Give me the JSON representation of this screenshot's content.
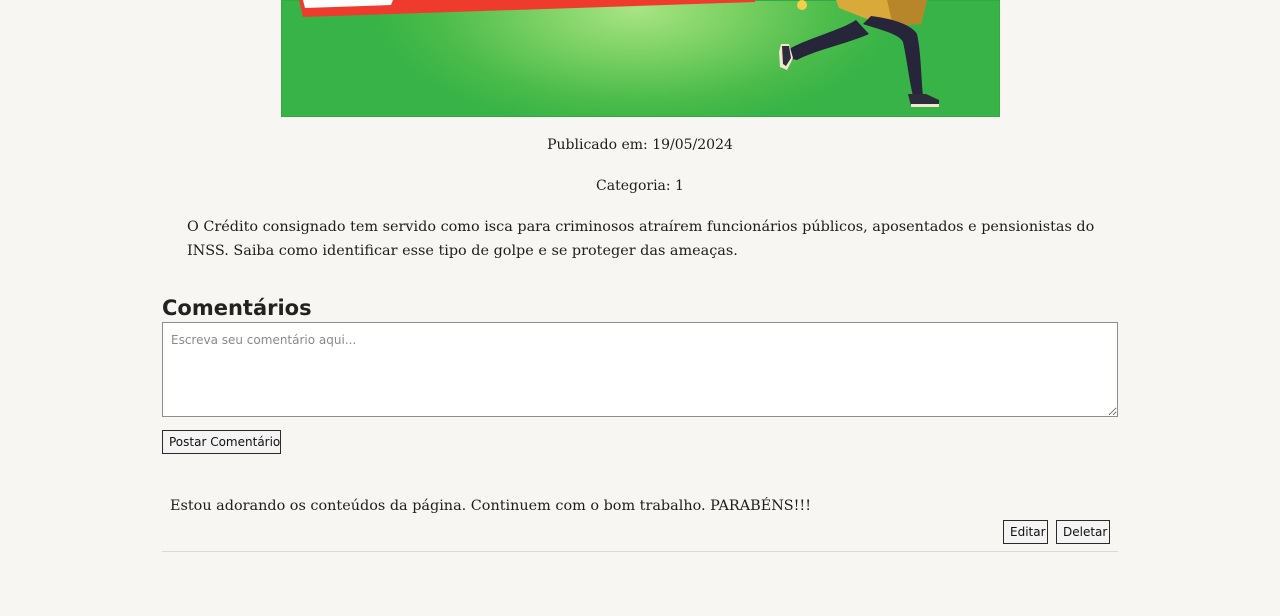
{
  "post": {
    "published_label": "Publicado em: 19/05/2024",
    "category_label": "Categoria: 1",
    "summary": "O Crédito consignado tem servido como isca para criminosos atraírem funcionários públicos, aposentados e pensionistas do INSS. Saiba como identificar esse tipo de golpe e se proteger das ameaças."
  },
  "comments": {
    "title": "Comentários",
    "input_placeholder": "Escreva seu comentário aqui...",
    "post_button": "Postar Comentário",
    "items": [
      {
        "text": "Estou adorando os conteúdos da página. Continuem com o bom trabalho. PARABÉNS!!!",
        "edit_label": "Editar",
        "delete_label": "Deletar"
      }
    ]
  },
  "colors": {
    "page_background": "#f8f6f2",
    "banner_green": "#38b347",
    "banner_red": "#ef3b2d"
  }
}
